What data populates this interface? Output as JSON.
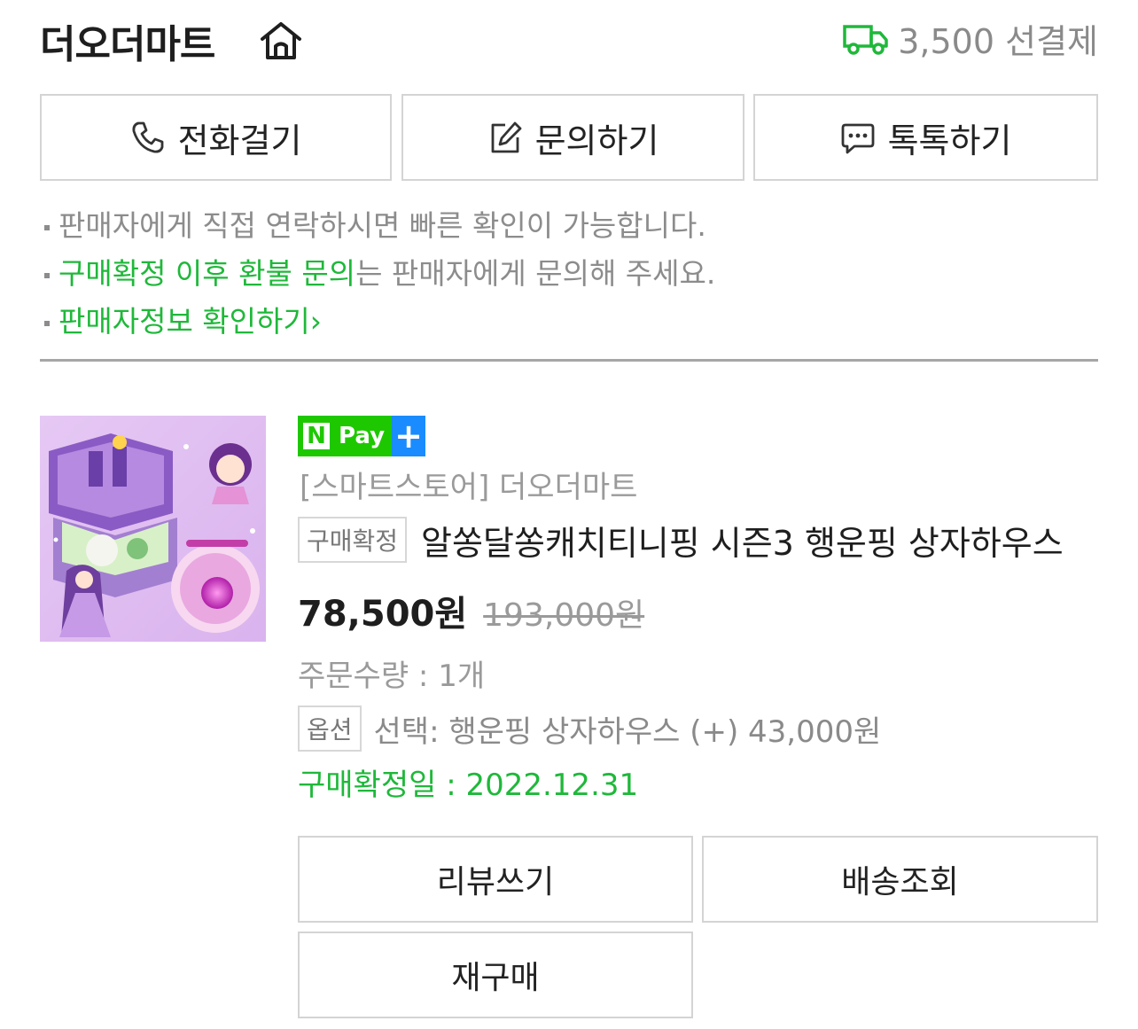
{
  "store": {
    "name": "더오더마트",
    "home_icon": "home-icon",
    "shipping_icon": "truck-icon",
    "shipping_text": "3,500 선결제"
  },
  "contact_buttons": [
    {
      "label": "전화걸기",
      "icon": "phone-icon"
    },
    {
      "label": "문의하기",
      "icon": "edit-icon"
    },
    {
      "label": "톡톡하기",
      "icon": "chat-icon"
    }
  ],
  "notes": {
    "line1": "판매자에게 직접 연락하시면 빠른 확인이 가능합니다.",
    "line2_highlight": "구매확정 이후 환불 문의",
    "line2_rest": "는 판매자에게 문의해 주세요.",
    "line3_link": "판매자정보 확인하기",
    "line3_arrow": "›"
  },
  "order": {
    "npay_n": "N",
    "npay_text": "Pay",
    "npay_plus": "+",
    "store_label": "[스마트스토어] 더오더마트",
    "status_badge": "구매확정",
    "product_name": "알쏭달쏭캐치티니핑 시즌3 행운핑 상자하우스",
    "price": "78,500원",
    "original_price": "193,000원",
    "quantity": "주문수량 : 1개",
    "option_badge": "옵션",
    "option_text": "선택: 행운핑 상자하우스 (+) 43,000원",
    "confirm_date": "구매확정일 : 2022.12.31"
  },
  "actions": {
    "review": "리뷰쓰기",
    "tracking": "배송조회",
    "reorder": "재구매"
  },
  "colors": {
    "accent_green": "#1fb83a",
    "npay_green": "#1ec800",
    "npay_blue": "#1a8cff"
  }
}
